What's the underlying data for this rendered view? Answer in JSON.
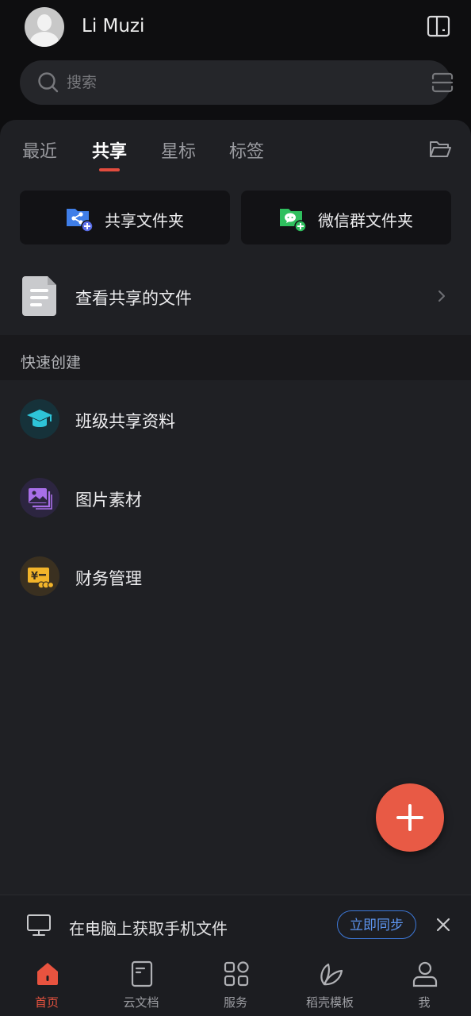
{
  "header": {
    "username": "Li Muzi"
  },
  "search": {
    "placeholder": "搜索"
  },
  "tabs": [
    {
      "label": "最近",
      "active": false
    },
    {
      "label": "共享",
      "active": true
    },
    {
      "label": "星标",
      "active": false
    },
    {
      "label": "标签",
      "active": false
    }
  ],
  "share_cards": [
    {
      "label": "共享文件夹",
      "icon": "shared-folder-icon"
    },
    {
      "label": "微信群文件夹",
      "icon": "wechat-folder-icon"
    }
  ],
  "shared_files": {
    "label": "查看共享的文件"
  },
  "quick_create": {
    "title": "快速创建",
    "items": [
      {
        "label": "班级共享资料",
        "icon": "graduation-cap-icon"
      },
      {
        "label": "图片素材",
        "icon": "image-gallery-icon"
      },
      {
        "label": "财务管理",
        "icon": "finance-icon"
      }
    ]
  },
  "sync_banner": {
    "text": "在电脑上获取手机文件",
    "button": "立即同步"
  },
  "bottom_nav": [
    {
      "label": "首页",
      "icon": "home-icon",
      "active": true
    },
    {
      "label": "云文档",
      "icon": "cloud-doc-icon",
      "active": false
    },
    {
      "label": "服务",
      "icon": "apps-grid-icon",
      "active": false
    },
    {
      "label": "稻壳模板",
      "icon": "leaf-icon",
      "active": false
    },
    {
      "label": "我",
      "icon": "user-icon",
      "active": false
    }
  ],
  "colors": {
    "accent": "#e85a45",
    "tab_indicator": "#e24c3e",
    "link_blue": "#3d78d8",
    "panel_bg": "#1f2024",
    "page_bg": "#0e0e10"
  }
}
